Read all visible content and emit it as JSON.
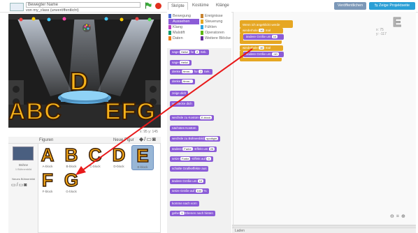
{
  "header": {
    "project_name": "Bewegter Name",
    "owner": "von my_class (unveröffentlicht)",
    "tabs": [
      "Skripte",
      "Kostüme",
      "Klänge"
    ],
    "publish_label": "Veröffentlichen",
    "project_page_label": "Zeige Projektseite"
  },
  "stage": {
    "letter_center": "D",
    "letters_left": "ABC",
    "letters_right": "EFG",
    "coords": "x: 95  y: 145"
  },
  "sprites": {
    "header_title": "Figuren",
    "new_sprite_label": "Neue Figur",
    "stage_label": "Bühne",
    "stage_sub": "1 Bühnenbild",
    "new_backdrop": "Neues Bühnenbild",
    "items": [
      {
        "glyph": "A",
        "caption": "A-block"
      },
      {
        "glyph": "B",
        "caption": "B-block"
      },
      {
        "glyph": "C",
        "caption": "C-block"
      },
      {
        "glyph": "D",
        "caption": "D-block"
      },
      {
        "glyph": "E",
        "caption": "E-block"
      },
      {
        "glyph": "F",
        "caption": "F-block"
      },
      {
        "glyph": "G",
        "caption": "G-block"
      }
    ]
  },
  "categories": {
    "left": [
      "Bewegung",
      "Aussehen",
      "Klang",
      "Malstift",
      "Daten"
    ],
    "right": [
      "Ereignisse",
      "Steuerung",
      "Fühlen",
      "Operatoren",
      "Weitere Blöcke"
    ],
    "colors": {
      "Bewegung": "#4a6cd4",
      "Aussehen": "#8b5cd7",
      "Klang": "#bb42c3",
      "Malstift": "#0e9a6c",
      "Daten": "#ee7d16",
      "Ereignisse": "#c88330",
      "Steuerung": "#e6a723",
      "Fühlen": "#2ca5e2",
      "Operatoren": "#5cb712",
      "Weitere Blöcke": "#632d99"
    }
  },
  "palette": {
    "blocks": [
      {
        "pre": "sage",
        "slot": "Hello!",
        "mid": "für",
        "slot2": "2",
        "post": "Sek."
      },
      {
        "pre": "sage",
        "slot": "Hello!",
        "mid": "",
        "slot2": "",
        "post": ""
      },
      {
        "pre": "denke",
        "slot": "Hmm...",
        "mid": "für",
        "slot2": "2",
        "post": "Sek."
      },
      {
        "pre": "denke",
        "slot": "Hmm...",
        "mid": "",
        "slot2": "",
        "post": ""
      },
      {
        "pre": "zeige dich",
        "slot": "",
        "mid": "",
        "slot2": "",
        "post": ""
      },
      {
        "pre": "verstecke dich",
        "slot": "",
        "mid": "",
        "slot2": "",
        "post": ""
      },
      {
        "pre": "wechsle zu Kostüm",
        "slot": "E-block",
        "mid": "",
        "slot2": "",
        "post": ""
      },
      {
        "pre": "nächstes Kostüm",
        "slot": "",
        "mid": "",
        "slot2": "",
        "post": ""
      },
      {
        "pre": "wechsle zu Bühnenbild",
        "slot": "spotlight",
        "mid": "",
        "slot2": "",
        "post": ""
      },
      {
        "pre": "ändere",
        "slot": "Farbe",
        "mid": "-Effekt um",
        "slot2": "25",
        "post": ""
      },
      {
        "pre": "setze",
        "slot": "Farbe",
        "mid": "-Effekt auf",
        "slot2": "0",
        "post": ""
      },
      {
        "pre": "schalte Grafikeffekte aus",
        "slot": "",
        "mid": "",
        "slot2": "",
        "post": ""
      },
      {
        "pre": "ändere Größe um",
        "slot": "10",
        "mid": "",
        "slot2": "",
        "post": ""
      },
      {
        "pre": "setze Größe auf",
        "slot": "100",
        "mid": "%",
        "slot2": "",
        "post": ""
      },
      {
        "pre": "komme nach vorn",
        "slot": "",
        "mid": "",
        "slot2": "",
        "post": ""
      },
      {
        "pre": "gehe",
        "slot": "1",
        "mid": "Ebenen nach hinten",
        "slot2": "",
        "post": ""
      }
    ]
  },
  "scripts": {
    "hat": "Wenn ich angeklickt werde",
    "block1_pre": "wiederhole",
    "block1_val": "10",
    "block1_post": "mal",
    "block2_pre": "ändere Größe um",
    "block2_val": "10",
    "block3_pre": "wiederhole",
    "block3_val": "10",
    "block3_post": "mal",
    "block4_pre": "ändere Größe um",
    "block4_val": "-10",
    "sprite_letter": "E",
    "sprite_x": "x: 75",
    "sprite_y": "y: -117",
    "bottom_label": "Laden"
  },
  "colors": {
    "arrow": "#e8191a",
    "looks": "#8b5cd7",
    "control": "#e6a723",
    "stage_bg": "#262626",
    "letter_fill": "#f7b31a"
  }
}
